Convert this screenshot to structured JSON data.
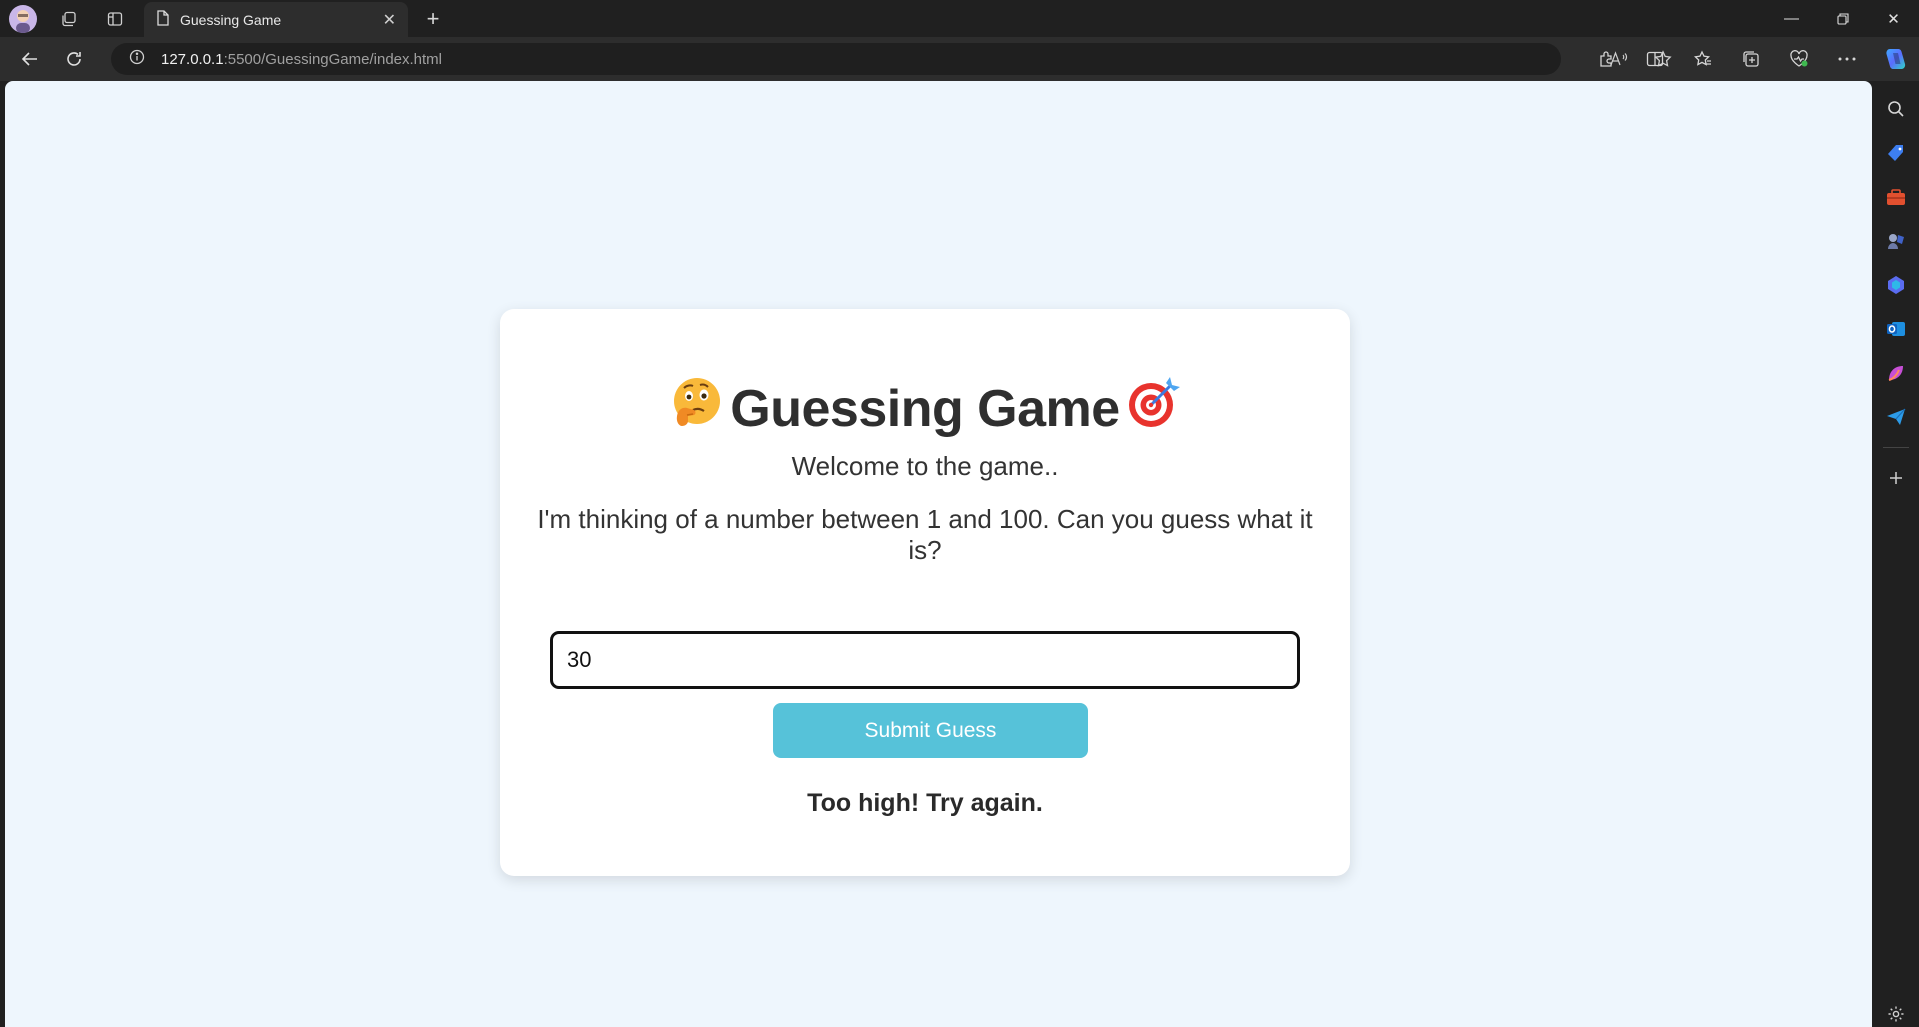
{
  "browser": {
    "tab_title": "Guessing Game",
    "url_host": "127.0.0.1",
    "url_rest": ":5500/GuessingGame/index.html"
  },
  "game": {
    "title": "Guessing Game",
    "welcome": "Welcome to the game..",
    "prompt": "I'm thinking of a number between 1 and 100. Can you guess what it is?",
    "guess_value": "30",
    "submit_label": "Submit Guess",
    "feedback": "Too high! Try again."
  },
  "colors": {
    "page_bg": "#eef6fd",
    "button": "#56c2d9",
    "chrome": "#202020"
  }
}
